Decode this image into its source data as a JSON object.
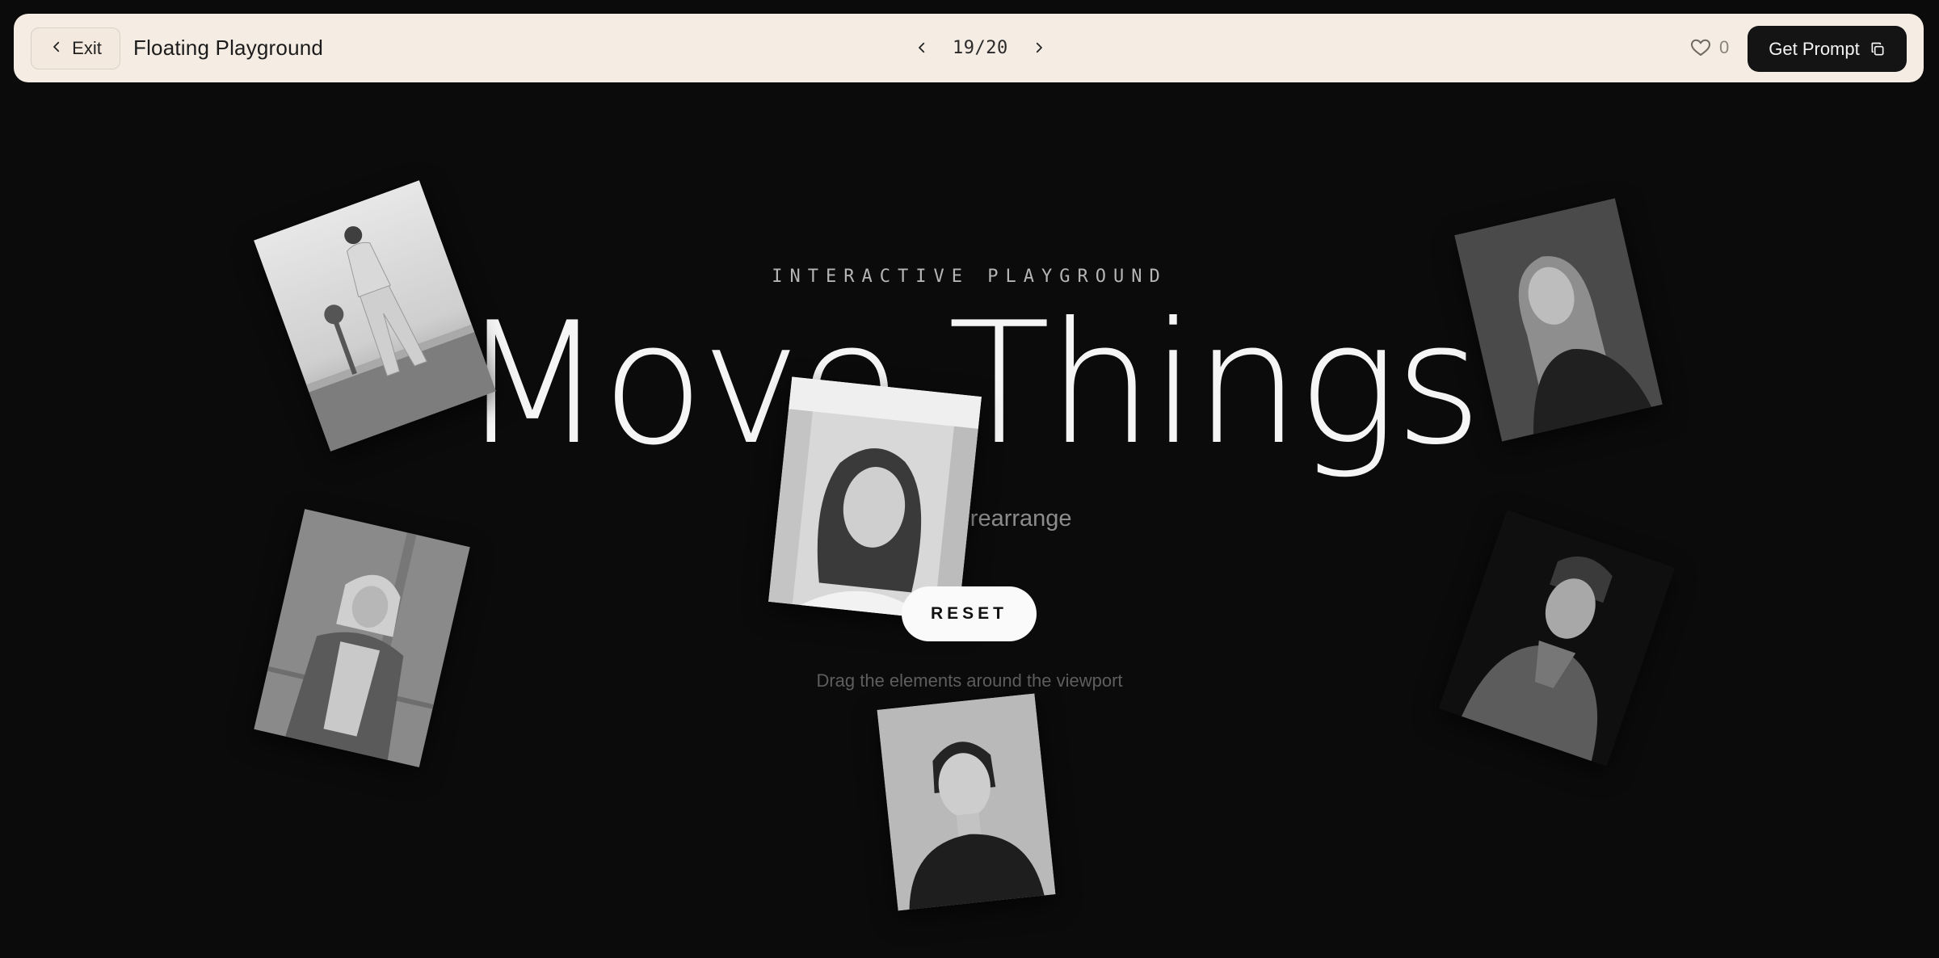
{
  "topbar": {
    "exit_label": "Exit",
    "title": "Floating Playground",
    "pager": "19/20",
    "likes": "0",
    "get_prompt_label": "Get Prompt"
  },
  "hero": {
    "eyebrow": "INTERACTIVE PLAYGROUND",
    "headline": "Move Things",
    "subtitle": "Drag and rearrange",
    "reset_label": "RESET",
    "hint": "Drag the elements around the viewport"
  },
  "icons": {
    "exit": "chevron-left-icon",
    "prev": "chevron-left-icon",
    "next": "chevron-right-icon",
    "like": "heart-icon",
    "copy": "copy-icon"
  },
  "colors": {
    "background": "#0b0b0b",
    "topbar": "#f5ece3",
    "button_dark": "#141414",
    "reset_button": "#fafafa"
  }
}
